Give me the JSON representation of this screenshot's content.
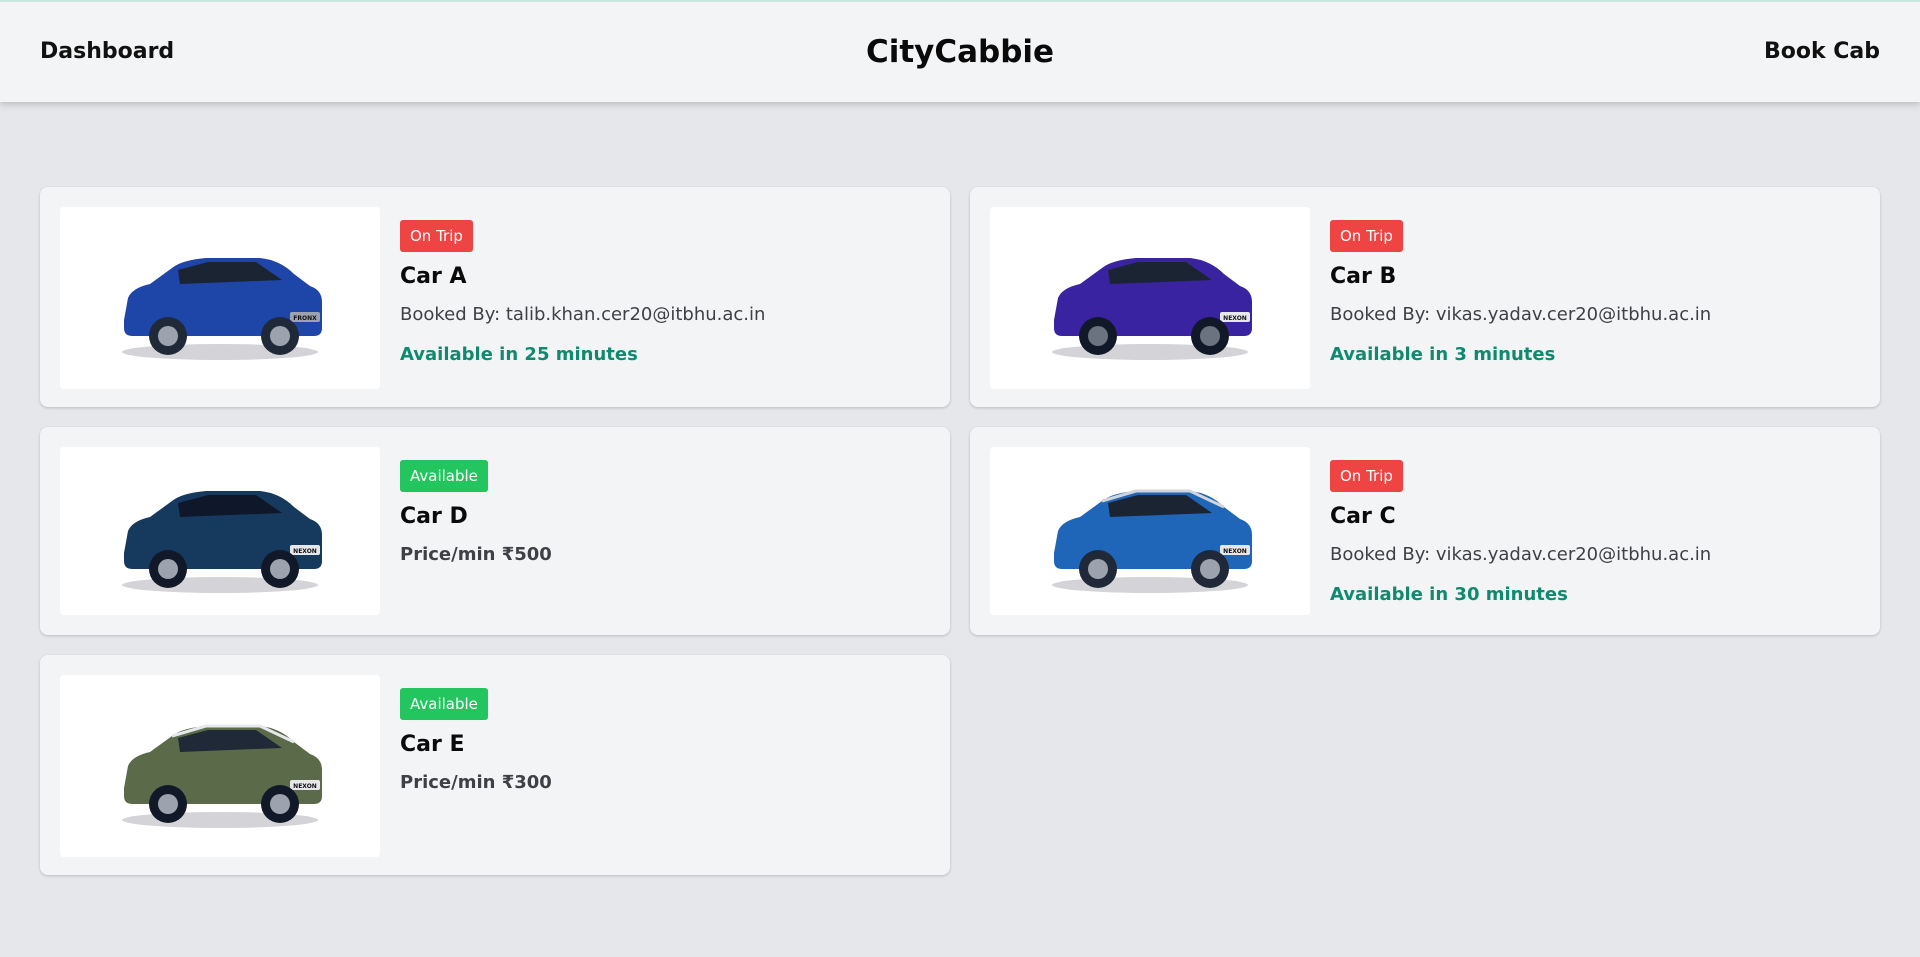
{
  "nav": {
    "left_link": "Dashboard",
    "brand": "CityCabbie",
    "right_link": "Book Cab"
  },
  "colors": {
    "on_trip_badge": "#ef4444",
    "available_badge": "#22c55e",
    "availability_text": "#0f8a6f"
  },
  "cars": [
    {
      "status": "On Trip",
      "name": "Car A",
      "booked_by": "Booked By: talib.khan.cer20@itbhu.ac.in",
      "availability": "Available in 25 minutes",
      "body_color": "#1e45a8",
      "plate": "FRONX"
    },
    {
      "status": "On Trip",
      "name": "Car B",
      "booked_by": "Booked By: vikas.yadav.cer20@itbhu.ac.in",
      "availability": "Available in 3 minutes",
      "body_color": "#3a23a0",
      "plate": "NEXON"
    },
    {
      "status": "Available",
      "name": "Car D",
      "price": "Price/min ₹500",
      "body_color": "#163a5e",
      "plate": "NEXON"
    },
    {
      "status": "On Trip",
      "name": "Car C",
      "booked_by": "Booked By: vikas.yadav.cer20@itbhu.ac.in",
      "availability": "Available in 30 minutes",
      "body_color": "#1f65b8",
      "plate": "NEXON"
    },
    {
      "status": "Available",
      "name": "Car E",
      "price": "Price/min ₹300",
      "body_color": "#5b6b4a",
      "plate": "NEXON"
    }
  ]
}
